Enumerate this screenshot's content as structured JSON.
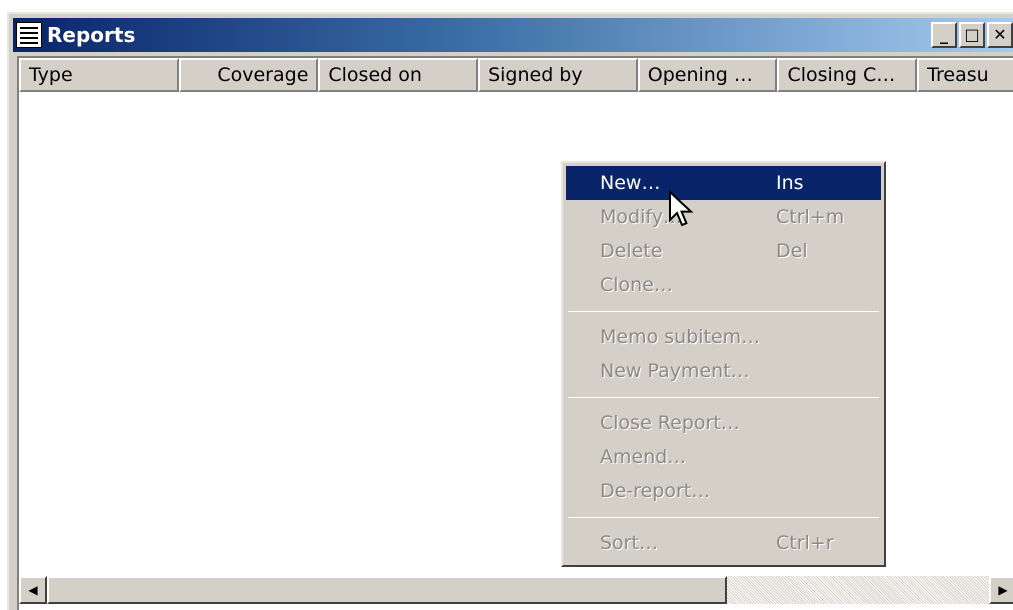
{
  "window": {
    "title": "Reports"
  },
  "caption_buttons": {
    "minimize": "_",
    "maximize": "□",
    "close": "✕"
  },
  "columns": [
    {
      "label": "Type"
    },
    {
      "label": "Coverage"
    },
    {
      "label": "Closed on"
    },
    {
      "label": "Signed by"
    },
    {
      "label": "Opening …"
    },
    {
      "label": "Closing C…"
    },
    {
      "label": "Treasu"
    }
  ],
  "context_menu": {
    "items": [
      {
        "label": "New…",
        "shortcut": "Ins"
      },
      {
        "label": "Modify…",
        "shortcut": "Ctrl+m"
      },
      {
        "label": "Delete",
        "shortcut": "Del"
      },
      {
        "label": "Clone…",
        "shortcut": ""
      },
      {
        "label": "Memo subitem…",
        "shortcut": ""
      },
      {
        "label": "New Payment…",
        "shortcut": ""
      },
      {
        "label": "Close Report…",
        "shortcut": ""
      },
      {
        "label": "Amend…",
        "shortcut": ""
      },
      {
        "label": "De-report…",
        "shortcut": ""
      },
      {
        "label": "Sort…",
        "shortcut": "Ctrl+r"
      }
    ]
  },
  "scrollbar": {
    "left_arrow": "◀",
    "right_arrow": "▶"
  },
  "icons": {
    "app": "list-window-icon",
    "cursor": "arrow-cursor-icon"
  }
}
